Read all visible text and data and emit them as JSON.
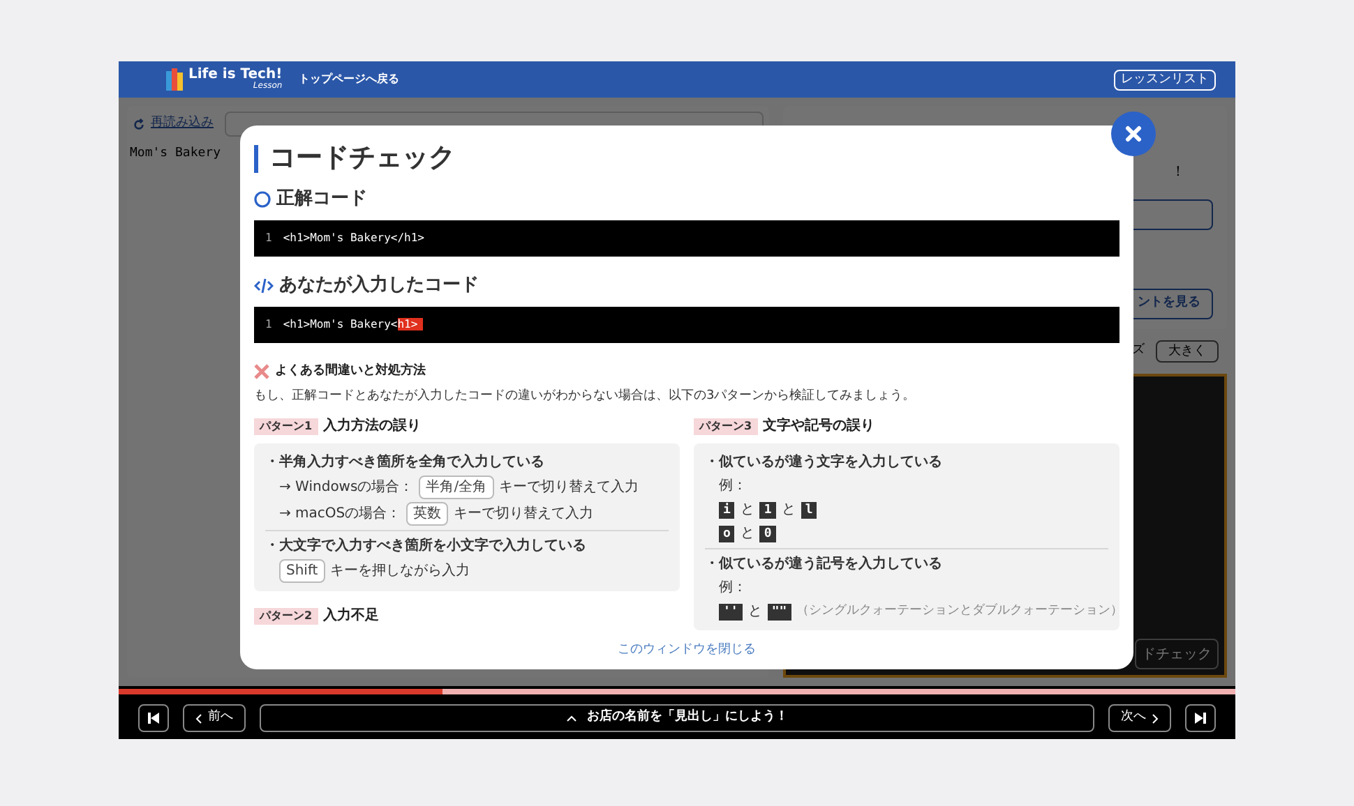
{
  "header": {
    "logo": "Life is Tech!",
    "logo_sub": "Lesson",
    "back_link": "トップページへ戻る",
    "lesson_list": "レッスンリスト"
  },
  "background": {
    "reload": "再読み込み",
    "preview_text": "Mom's Bakery",
    "right_text": "！",
    "hint_button": "ントを見る",
    "size_label": "ズ",
    "size_button": "大きく",
    "check_button": "ドチェック"
  },
  "modal": {
    "title": "コードチェック",
    "correct": {
      "heading": "正解コード",
      "lines": [
        {
          "number": "1",
          "segments": [
            {
              "text": "<h1>Mom's Bakery</h1>",
              "error": false
            }
          ]
        }
      ]
    },
    "yours": {
      "heading": "あなたが入力したコード",
      "lines": [
        {
          "number": "1",
          "segments": [
            {
              "text": "<h1>Mom's Bakery<",
              "error": false
            },
            {
              "text": "h1>",
              "error": true
            }
          ]
        }
      ]
    },
    "mistakes": {
      "heading": "よくある間違いと対処方法",
      "intro": "もし、正解コードとあなたが入力したコードの違いがわからない場合は、以下の3パターンから検証してみましょう。",
      "columns": [
        [
          {
            "tag": "パターン1",
            "title": "入力方法の誤り",
            "items": [
              {
                "text": "・半角入力すべき箇所を全角で入力している",
                "lines": [
                  [
                    {
                      "kind": "text",
                      "text": "→ Windowsの場合："
                    },
                    {
                      "kind": "key",
                      "text": "半角/全角"
                    },
                    {
                      "kind": "text",
                      "text": "キーで切り替えて入力"
                    }
                  ],
                  [
                    {
                      "kind": "text",
                      "text": "→ macOSの場合："
                    },
                    {
                      "kind": "key",
                      "text": "英数"
                    },
                    {
                      "kind": "text",
                      "text": "キーで切り替えて入力"
                    }
                  ]
                ]
              },
              {
                "text": "・大文字で入力すべき箇所を小文字で入力している",
                "lines": [
                  [
                    {
                      "kind": "key",
                      "text": "Shift"
                    },
                    {
                      "kind": "text",
                      "text": "キーを押しながら入力"
                    }
                  ]
                ]
              }
            ]
          },
          {
            "tag": "パターン2",
            "title": "入力不足"
          }
        ],
        [
          {
            "tag": "パターン3",
            "title": "文字や記号の誤り",
            "items": [
              {
                "text": "・似ているが違う文字を入力している",
                "lines": [
                  [
                    {
                      "kind": "text",
                      "text": "例："
                    }
                  ],
                  [
                    {
                      "kind": "char",
                      "text": "i"
                    },
                    {
                      "kind": "text",
                      "text": "と"
                    },
                    {
                      "kind": "char",
                      "text": "1"
                    },
                    {
                      "kind": "text",
                      "text": "と"
                    },
                    {
                      "kind": "char",
                      "text": "l"
                    }
                  ],
                  [
                    {
                      "kind": "char",
                      "text": "o"
                    },
                    {
                      "kind": "text",
                      "text": "と"
                    },
                    {
                      "kind": "char",
                      "text": "0"
                    }
                  ]
                ]
              },
              {
                "text": "・似ているが違う記号を入力している",
                "lines": [
                  [
                    {
                      "kind": "text",
                      "text": "例："
                    }
                  ],
                  [
                    {
                      "kind": "char",
                      "text": "''"
                    },
                    {
                      "kind": "text",
                      "text": "と"
                    },
                    {
                      "kind": "char",
                      "text": "\"\""
                    },
                    {
                      "kind": "note",
                      "text": "（シングルクォーテーションとダブルクォーテーション）"
                    }
                  ]
                ]
              }
            ]
          }
        ]
      ]
    },
    "close_link": "このウィンドウを閉じる"
  },
  "footer": {
    "progress": {
      "level": 0.29
    },
    "prev": "前へ",
    "step_title": "お店の名前を「見出し」にしよう！",
    "next": "次へ"
  }
}
